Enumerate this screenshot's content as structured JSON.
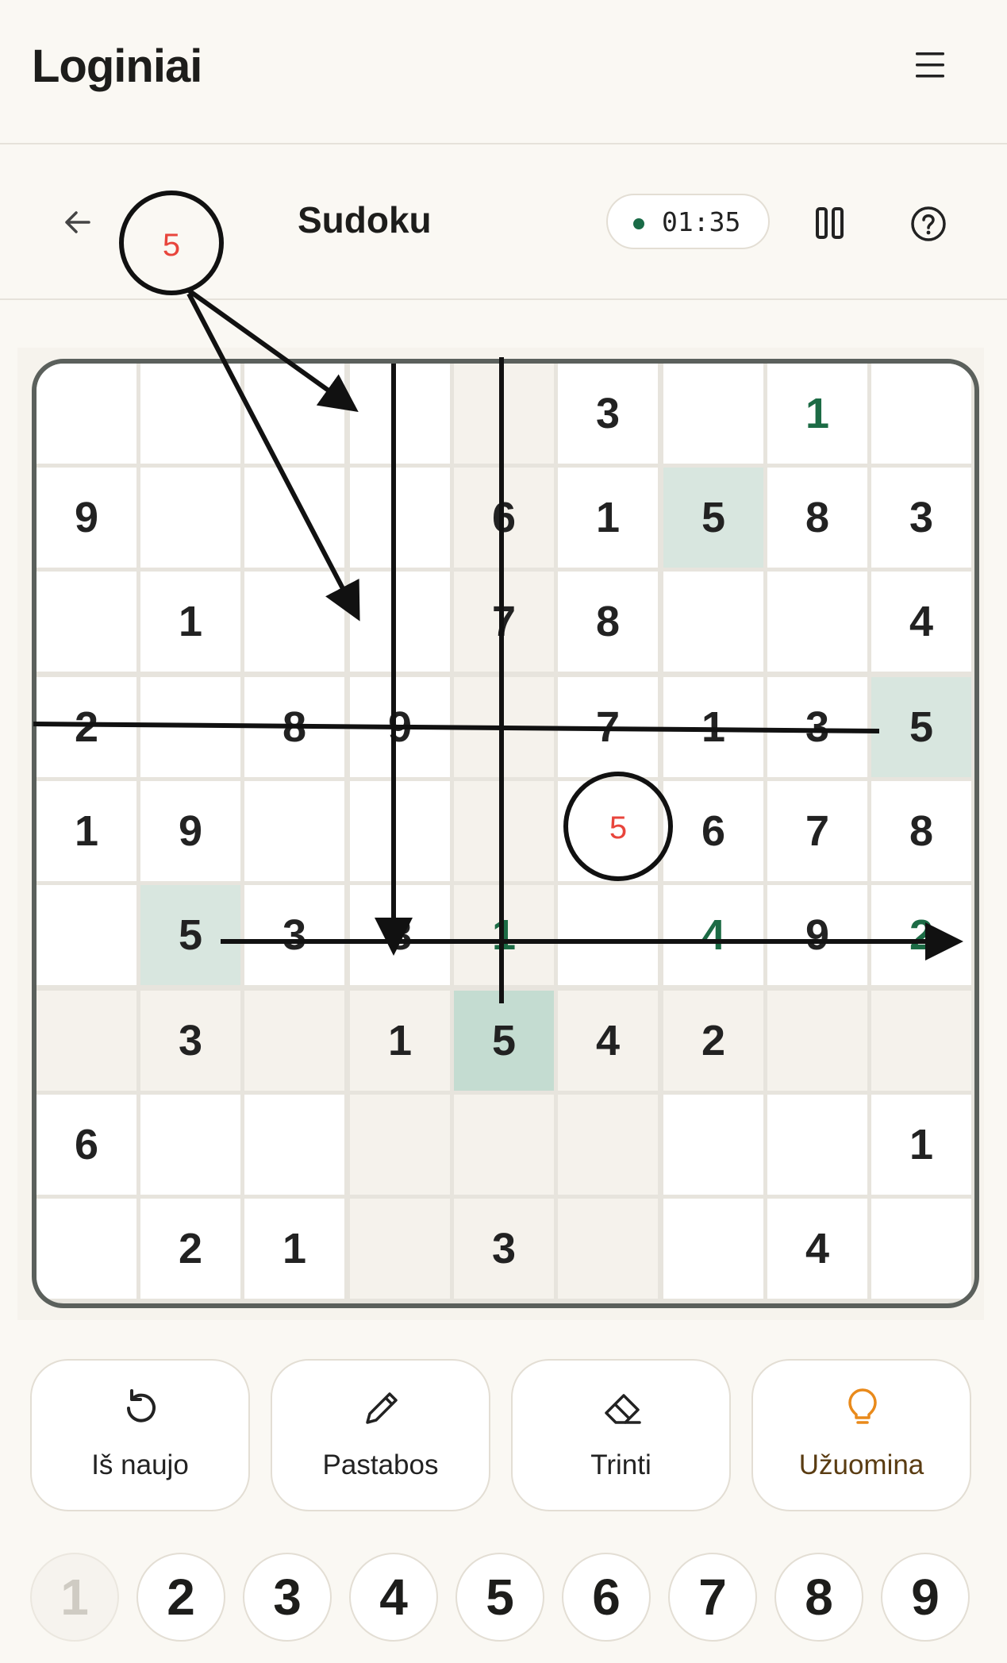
{
  "app": {
    "logo": "Loginiai"
  },
  "header": {
    "title": "Sudoku",
    "timer": "01:35",
    "menu_icon": "hamburger-icon",
    "back_icon": "arrow-left-icon",
    "pause_icon": "pause-icon",
    "help_icon": "question-icon"
  },
  "board": {
    "rows": [
      [
        "",
        "",
        "",
        "",
        "",
        "3",
        "",
        "1",
        ""
      ],
      [
        "9",
        "",
        "",
        "",
        "6",
        "1",
        "5",
        "8",
        "3"
      ],
      [
        "",
        "1",
        "",
        "",
        "7",
        "8",
        "",
        "",
        "4"
      ],
      [
        "2",
        "",
        "8",
        "9",
        "",
        "7",
        "1",
        "3",
        "5"
      ],
      [
        "1",
        "9",
        "",
        "",
        "",
        "",
        "6",
        "7",
        "8"
      ],
      [
        "",
        "5",
        "3",
        "8",
        "1",
        "",
        "4",
        "9",
        "2"
      ],
      [
        "",
        "3",
        "",
        "1",
        "5",
        "4",
        "2",
        "",
        ""
      ],
      [
        "6",
        "",
        "",
        "",
        "",
        "",
        "",
        "",
        "1"
      ],
      [
        "",
        "2",
        "1",
        "",
        "3",
        "",
        "",
        "4",
        ""
      ]
    ],
    "green_digits": [
      [
        0,
        7
      ],
      [
        5,
        4
      ],
      [
        5,
        6
      ],
      [
        5,
        8
      ]
    ],
    "selected_cell": [
      6,
      4
    ],
    "same_digit_cells": [
      [
        1,
        6
      ],
      [
        3,
        8
      ],
      [
        5,
        1
      ]
    ],
    "selected_value": "5"
  },
  "annotation": {
    "floating_digit": "5",
    "target_digit": "5",
    "colors": {
      "ink": "#111111",
      "digit": "#e8453c"
    }
  },
  "actions": [
    {
      "label": "Iš naujo",
      "icon": "restart-icon"
    },
    {
      "label": "Pastabos",
      "icon": "pencil-icon"
    },
    {
      "label": "Trinti",
      "icon": "eraser-icon"
    },
    {
      "label": "Užuomina",
      "icon": "lightbulb-icon"
    }
  ],
  "numpad": [
    "1",
    "2",
    "3",
    "4",
    "5",
    "6",
    "7",
    "8",
    "9"
  ],
  "numpad_completed": [
    "1"
  ],
  "colors": {
    "accent": "#1c6b45",
    "highlight": "#d8e6df",
    "selected": "#c4dcd1",
    "hint": "#e98a1b"
  }
}
